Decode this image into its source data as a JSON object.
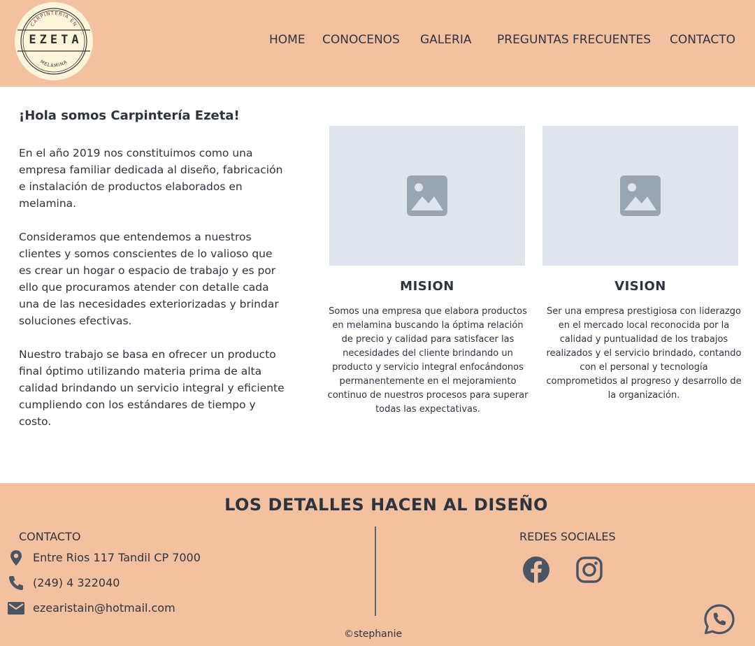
{
  "header": {
    "logo": {
      "word": "EZETA",
      "top_arc": "CARPINTERIA EN",
      "bottom_arc": "MELAMINA"
    },
    "nav": [
      {
        "label": "HOME"
      },
      {
        "label": "CONOCENOS"
      },
      {
        "label": "GALERIA"
      },
      {
        "label": "PREGUNTAS FRECUENTES"
      },
      {
        "label": "CONTACTO"
      }
    ]
  },
  "intro": {
    "title": "¡Hola somos Carpintería Ezeta!",
    "paragraphs": [
      "En el año 2019 nos constituimos como una empresa familiar dedicada al diseño, fabricación e instalación de productos elaborados en melamina.",
      "Consideramos que entendemos a nuestros clientes y somos conscientes de lo valioso que es crear un hogar o espacio de trabajo y es por ello que procuramos atender con detalle cada una de las necesidades exteriorizadas y brindar soluciones efectivas.",
      "Nuestro trabajo se basa en ofrecer un producto final óptimo utilizando materia prima de alta calidad brindando un servicio integral y eficiente cumpliendo con los estándares de tiempo y costo."
    ]
  },
  "cards": [
    {
      "title": "MISION",
      "image_icon": "image-placeholder-icon",
      "text": "Somos una empresa que elabora productos en melamina buscando la óptima relación de precio y calidad para satisfacer las necesidades del cliente brindando un producto y servicio integral enfocándonos permanentemente en el mejoramiento continuo de nuestros procesos para superar todas las expectativas."
    },
    {
      "title": "VISION",
      "image_icon": "image-placeholder-icon",
      "text": "Ser una empresa prestigiosa con liderazgo en el mercado local reconocida por la calidad y puntualidad de los trabajos realizados y el servicio brindado, contando con el personal y tecnología comprometidos al progreso y desarrollo de la organización."
    }
  ],
  "footer": {
    "title": "LOS DETALLES HACEN AL DISEÑO",
    "contact": {
      "heading": "CONTACTO",
      "address": "Entre Rios 117 Tandil CP 7000",
      "phone": "(249) 4 322040",
      "email": "ezearistain@hotmail.com"
    },
    "social": {
      "heading": "REDES SOCIALES",
      "icons": [
        "facebook-icon",
        "instagram-icon"
      ]
    },
    "copyright": "©stephanie",
    "floating_icon": "whatsapp-icon"
  },
  "colors": {
    "header_bg": "#f3c19f",
    "footer_bg": "#f3c19f",
    "text": "#2c3440",
    "placeholder_bg": "#dfe5ed",
    "placeholder_icon": "#9aa5b2",
    "icon": "#4a5563"
  }
}
